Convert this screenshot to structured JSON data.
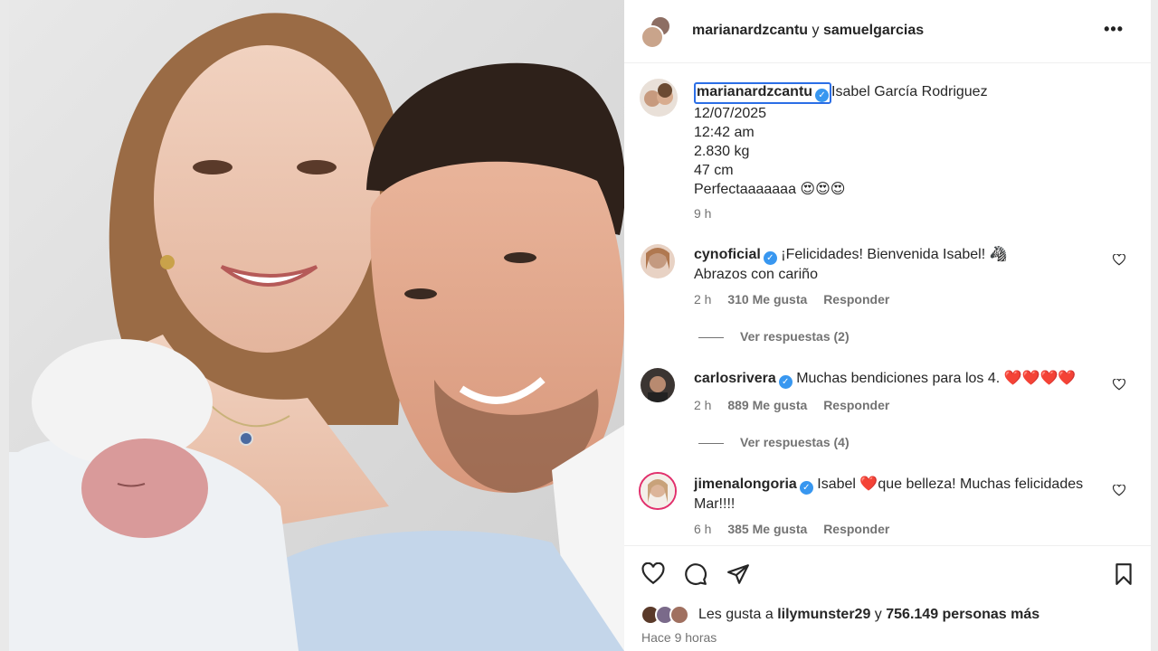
{
  "post": {
    "header": {
      "author1": "marianardzcantu",
      "joiner": "y",
      "author2": "samuelgarcias"
    },
    "caption": {
      "username": "marianardzcantu",
      "lines": [
        "Isabel García Rodriguez",
        "12/07/2025",
        "12:42 am",
        "2.830 kg",
        "47 cm",
        "Perfectaaaaaaa 😍😍😍"
      ],
      "time": "9 h"
    },
    "comments": [
      {
        "username": "cynoficial",
        "text_line1": "¡Felicidades! Bienvenida Isabel! 🦓",
        "text_line2": "Abrazos con cariño",
        "time": "2 h",
        "likes": "310 Me gusta",
        "reply": "Responder",
        "replies": "Ver respuestas (2)"
      },
      {
        "username": "carlosrivera",
        "text_line1": "Muchas bendiciones para los 4. ❤️❤️❤️❤️",
        "text_line2": "",
        "time": "2 h",
        "likes": "889 Me gusta",
        "reply": "Responder",
        "replies": "Ver respuestas (4)"
      },
      {
        "username": "jimenalongoria",
        "text_line1": "Isabel ❤️que belleza! Muchas felicidades",
        "text_line2": "Mar!!!!",
        "time": "6 h",
        "likes": "385 Me gusta",
        "reply": "Responder"
      }
    ],
    "likes": {
      "prefix": "Les gusta a",
      "user": "lilymunster29",
      "middle": "y",
      "count": "756.149 personas más"
    },
    "posted_ago": "Hace 9 horas"
  },
  "icons": {
    "more": "more-horizontal-icon",
    "verified": "verified-badge-icon",
    "heart": "heart-icon",
    "comment": "comment-icon",
    "share": "send-icon",
    "save": "bookmark-icon"
  },
  "colors": {
    "verified": "#3897f0",
    "focus": "#2b6ee6",
    "muted": "#737373"
  }
}
